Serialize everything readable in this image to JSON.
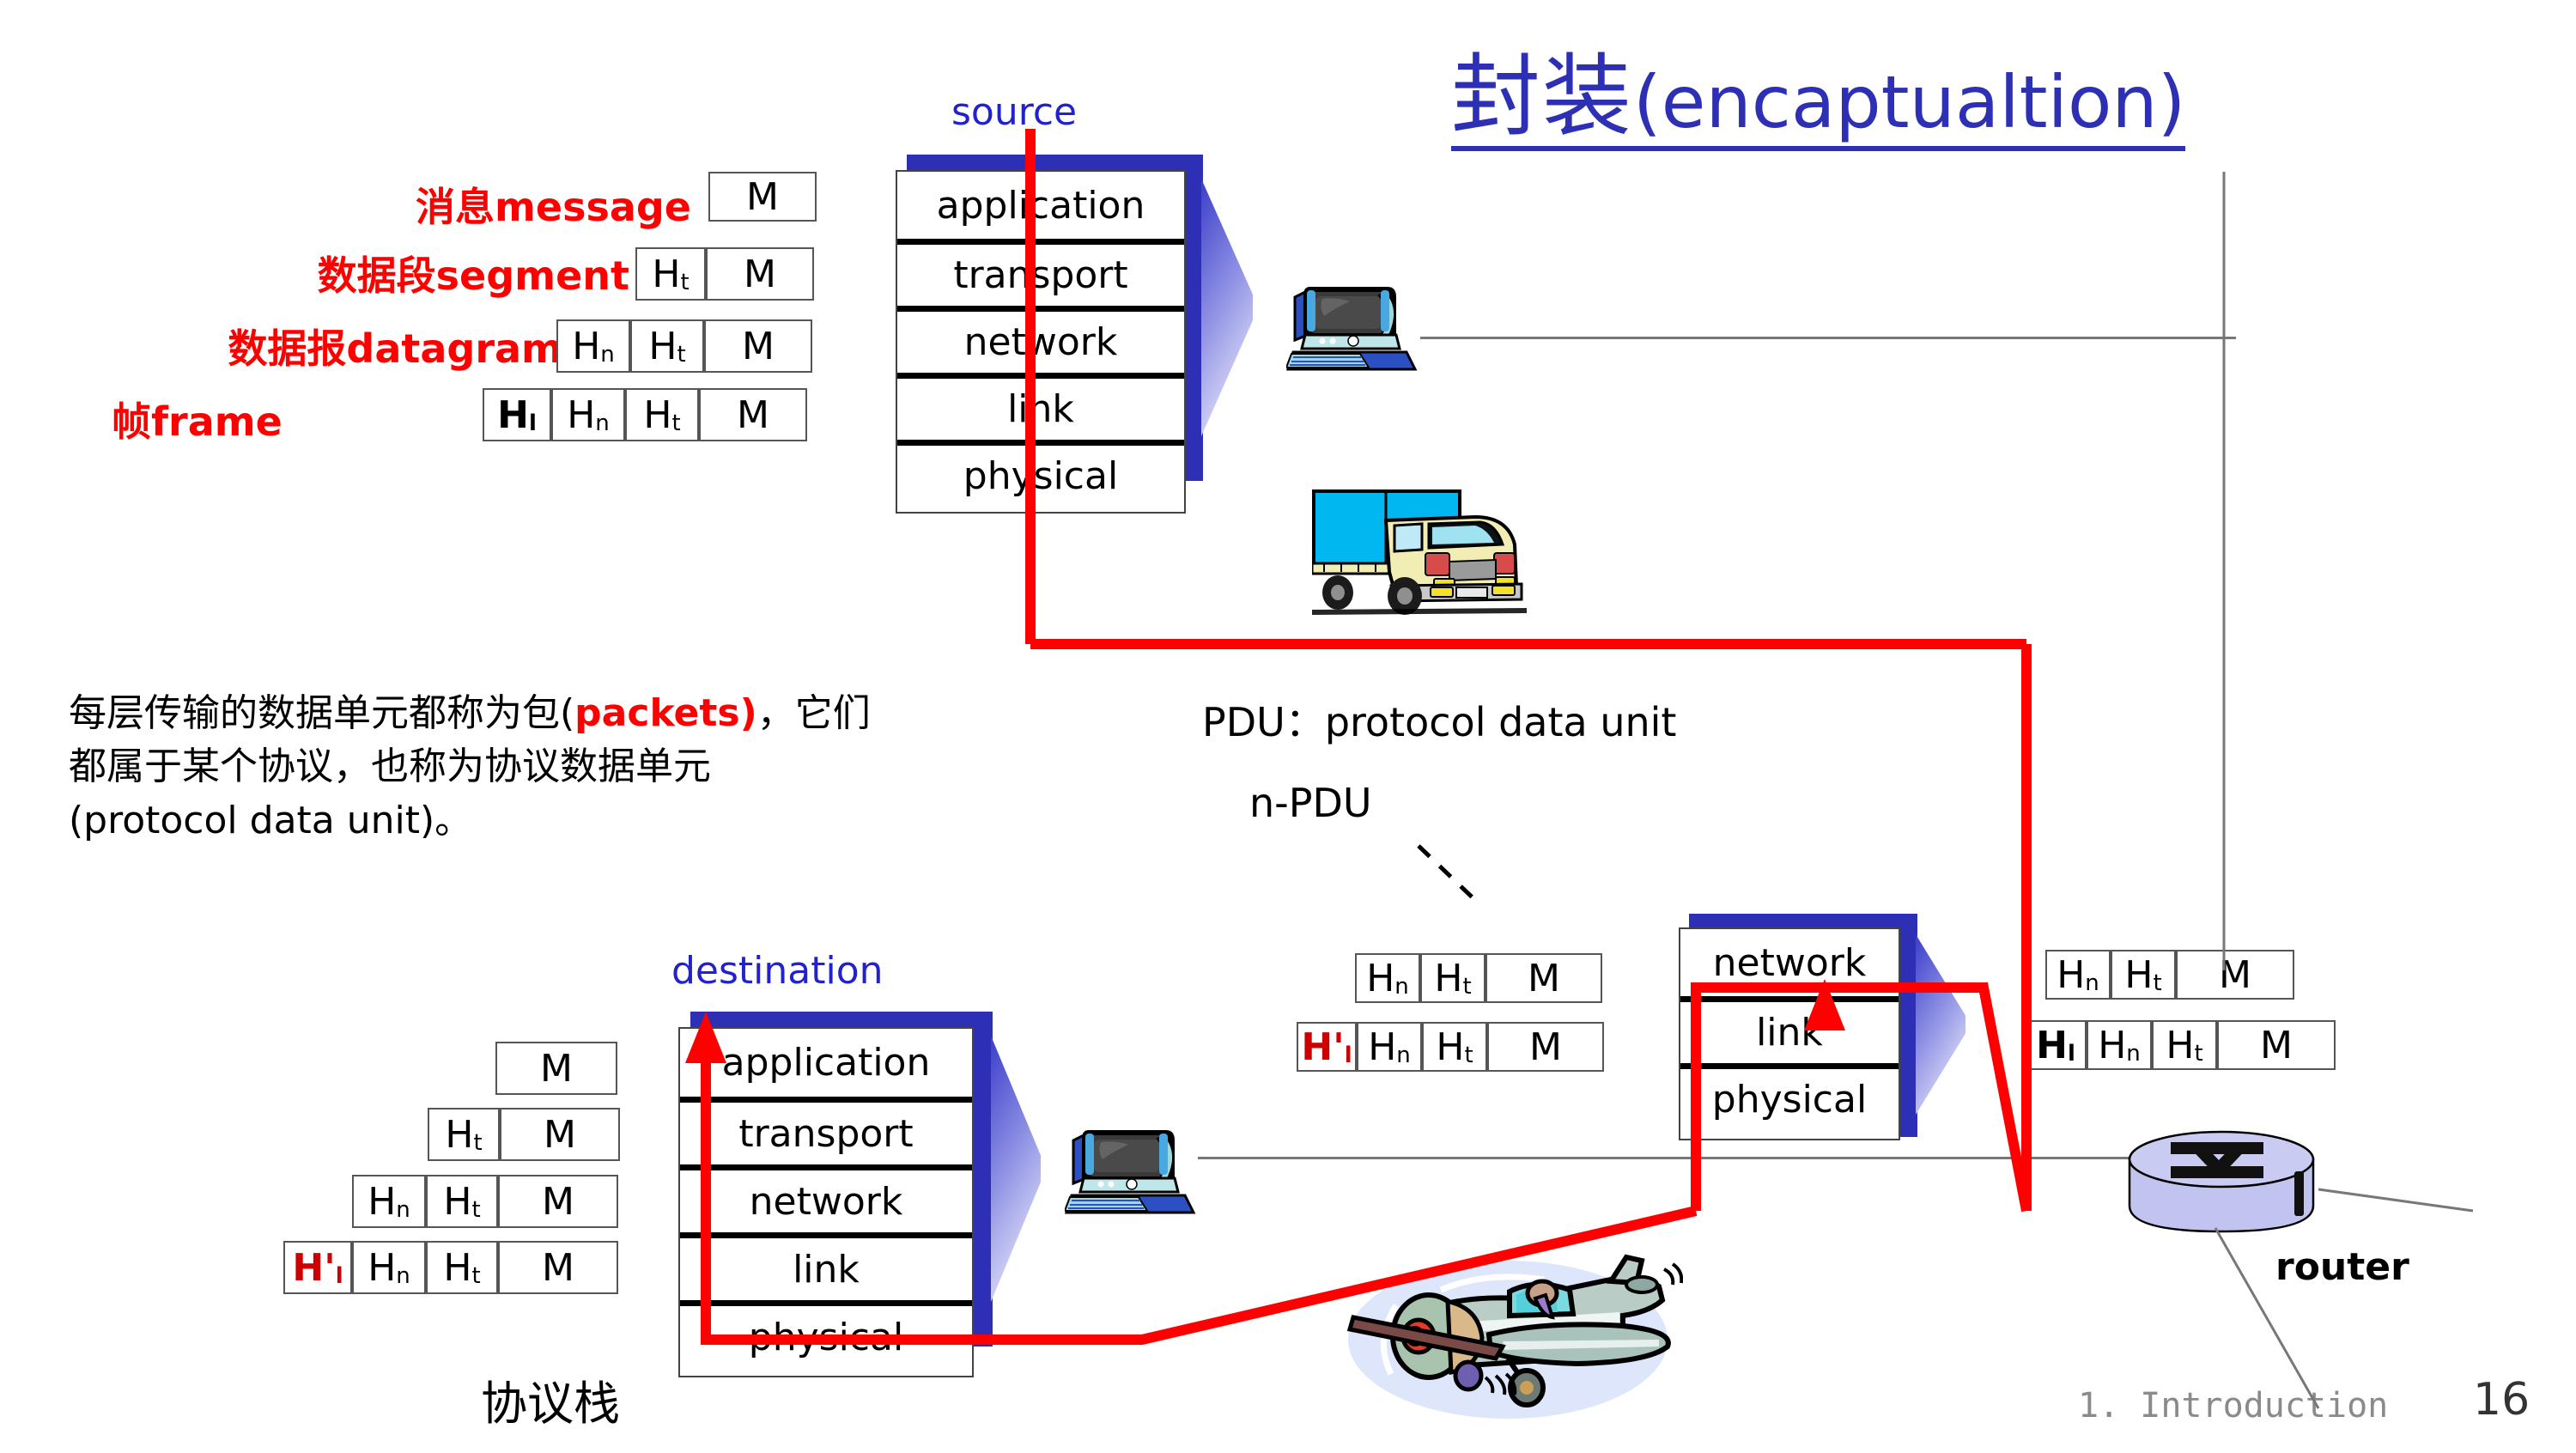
{
  "title": {
    "cn": "封装",
    "en": "(encaptualtion)"
  },
  "endpoints": {
    "source": "source",
    "destination": "destination"
  },
  "stack_caption": "协议栈",
  "router_label": "router",
  "encapsulation_rows": [
    {
      "label": "消息message",
      "cells": [
        "M"
      ]
    },
    {
      "label": "数据段segment",
      "cells": [
        "Ht",
        "M"
      ]
    },
    {
      "label": "数据报datagram",
      "cells": [
        "Hn",
        "Ht",
        "M"
      ]
    },
    {
      "label": "帧frame",
      "cells": [
        "Hl",
        "Hn",
        "Ht",
        "M"
      ]
    }
  ],
  "header_glyphs": {
    "M": {
      "base": "M",
      "sub": ""
    },
    "Ht": {
      "base": "H",
      "sub": "t"
    },
    "Hn": {
      "base": "H",
      "sub": "n"
    },
    "Hl": {
      "base": "H",
      "sub": "l"
    },
    "Hl_prime": {
      "base": "H'",
      "sub": "l"
    }
  },
  "source_stack": {
    "title": "source",
    "layers": [
      "application",
      "transport",
      "network",
      "link",
      "physical"
    ]
  },
  "destination_stack": {
    "title": "destination",
    "layers": [
      "application",
      "transport",
      "network",
      "link",
      "physical"
    ]
  },
  "router_stack": {
    "layers": [
      "network",
      "link",
      "physical"
    ]
  },
  "destination_packets": [
    {
      "cells": [
        "M"
      ]
    },
    {
      "cells": [
        "Ht",
        "M"
      ]
    },
    {
      "cells": [
        "Hn",
        "Ht",
        "M"
      ]
    },
    {
      "cells": [
        "Hl_prime",
        "Hn",
        "Ht",
        "M"
      ]
    }
  ],
  "router_left_packets": [
    {
      "cells": [
        "Hn",
        "Ht",
        "M"
      ]
    },
    {
      "cells": [
        "Hl_prime",
        "Hn",
        "Ht",
        "M"
      ]
    }
  ],
  "router_right_packets": [
    {
      "cells": [
        "Hn",
        "Ht",
        "M"
      ]
    },
    {
      "cells": [
        "Hl",
        "Hn",
        "Ht",
        "M"
      ]
    }
  ],
  "body_paragraph": {
    "line1_a": "每层传输的数据单元都称为包(",
    "line1_hl": "packets)",
    "line1_b": "，它们",
    "line2": "都属于某个协议，也称为协议数据单元",
    "line3": "(protocol data unit)。"
  },
  "pdu_notes": {
    "full": "PDU：protocol data unit",
    "n_pdu": "n-PDU"
  },
  "footer": {
    "chapter": "1. Introduction",
    "page": "16"
  },
  "colors": {
    "title_blue": "#2d2fb5",
    "caption_blue": "#2222cc",
    "red_label": "#ff0000",
    "path_red": "#ff0000",
    "router_fill": "#c2c4f0",
    "truck_body": "#00b7ef",
    "footer_gray": "#8a8a8a"
  },
  "icons": {
    "pc_source": "desktop-computer-icon",
    "pc_destination": "desktop-computer-icon",
    "truck": "delivery-truck-icon",
    "plane": "airplane-icon",
    "router": "router-cylinder-icon"
  }
}
